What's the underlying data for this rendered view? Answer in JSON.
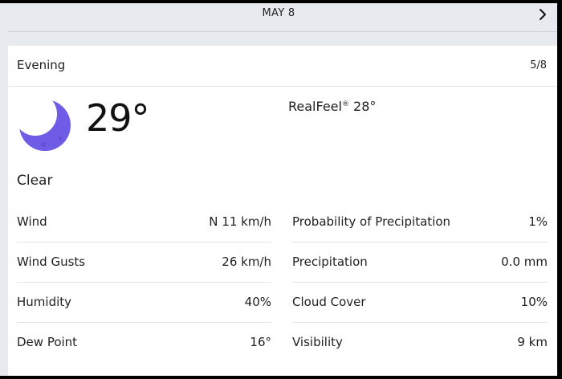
{
  "date_bar": {
    "date": "MAY 8"
  },
  "card": {
    "period": "Evening",
    "pager": "5/8",
    "icon": "crescent-moon-icon",
    "temperature": "29°",
    "realfeel_label": "RealFeel",
    "realfeel_mark": "®",
    "realfeel_value": "28°",
    "condition": "Clear"
  },
  "details": {
    "left": [
      {
        "label": "Wind",
        "value": "N 11 km/h"
      },
      {
        "label": "Wind Gusts",
        "value": "26 km/h"
      },
      {
        "label": "Humidity",
        "value": "40%"
      },
      {
        "label": "Dew Point",
        "value": "16°"
      }
    ],
    "right": [
      {
        "label": "Probability of Precipitation",
        "value": "1%"
      },
      {
        "label": "Precipitation",
        "value": "0.0 mm"
      },
      {
        "label": "Cloud Cover",
        "value": "10%"
      },
      {
        "label": "Visibility",
        "value": "9 km"
      }
    ]
  },
  "colors": {
    "moon": "#6f5ce6",
    "moon_shade": "#5a48cf",
    "background": "#e7ebf0",
    "card": "#ffffff"
  }
}
